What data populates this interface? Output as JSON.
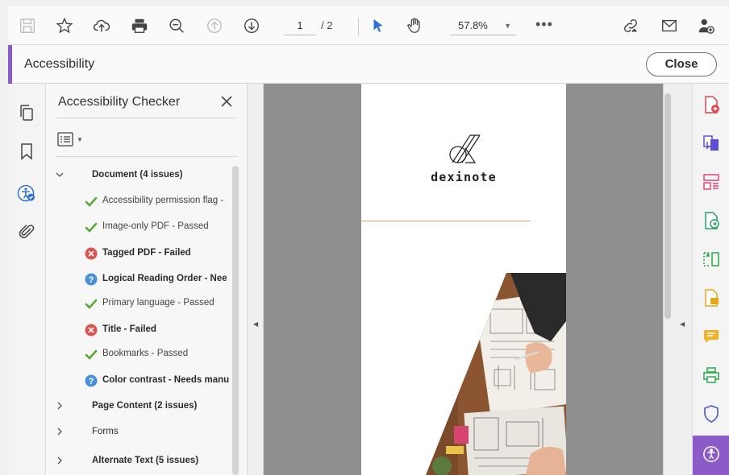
{
  "toolbar": {
    "page_current": "1",
    "page_total": "/ 2",
    "zoom": "57.8%",
    "more": "•••"
  },
  "titlebar": {
    "title": "Accessibility",
    "close_label": "Close"
  },
  "panel": {
    "title": "Accessibility Checker",
    "groups": [
      {
        "label": "Document (4 issues)",
        "expanded": true
      },
      {
        "label": "Page Content (2 issues)",
        "expanded": false
      },
      {
        "label": "Forms",
        "expanded": false
      },
      {
        "label": "Alternate Text (5 issues)",
        "expanded": false
      }
    ],
    "items": [
      {
        "status": "passed",
        "text": "Accessibility permission flag -"
      },
      {
        "status": "passed",
        "text": "Image-only PDF - Passed"
      },
      {
        "status": "failed",
        "text": "Tagged PDF - Failed"
      },
      {
        "status": "manual",
        "text": "Logical Reading Order - Nee"
      },
      {
        "status": "passed",
        "text": "Primary language - Passed"
      },
      {
        "status": "failed",
        "text": "Title - Failed"
      },
      {
        "status": "passed",
        "text": "Bookmarks - Passed"
      },
      {
        "status": "manual",
        "text": "Color contrast - Needs manu"
      }
    ]
  },
  "document": {
    "brand": "dexinote"
  },
  "colors": {
    "accent": "#8b5cc9",
    "passed": "#5aa83c",
    "failed": "#d9534f",
    "manual": "#4a90d9"
  }
}
